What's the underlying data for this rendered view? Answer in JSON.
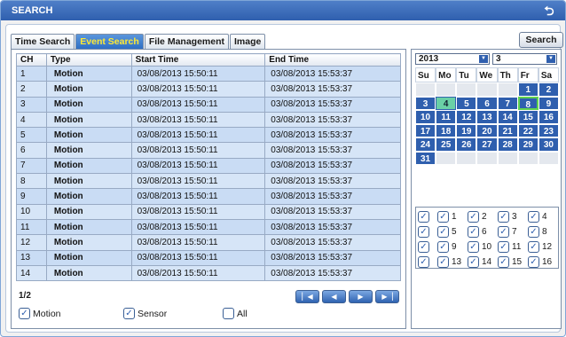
{
  "window": {
    "title": "SEARCH",
    "back_icon": "back-arrow-icon"
  },
  "tabs": [
    {
      "label": "Time Search",
      "active": false
    },
    {
      "label": "Event Search",
      "active": true
    },
    {
      "label": "File Management",
      "active": false
    },
    {
      "label": "Image",
      "active": false
    }
  ],
  "search_button": {
    "label": "Search"
  },
  "table": {
    "headers": [
      "CH",
      "Type",
      "Start Time",
      "End Time"
    ],
    "rows": [
      {
        "ch": "1",
        "type": "Motion",
        "start": "03/08/2013 15:50:11",
        "end": "03/08/2013 15:53:37"
      },
      {
        "ch": "2",
        "type": "Motion",
        "start": "03/08/2013 15:50:11",
        "end": "03/08/2013 15:53:37"
      },
      {
        "ch": "3",
        "type": "Motion",
        "start": "03/08/2013 15:50:11",
        "end": "03/08/2013 15:53:37"
      },
      {
        "ch": "4",
        "type": "Motion",
        "start": "03/08/2013 15:50:11",
        "end": "03/08/2013 15:53:37"
      },
      {
        "ch": "5",
        "type": "Motion",
        "start": "03/08/2013 15:50:11",
        "end": "03/08/2013 15:53:37"
      },
      {
        "ch": "6",
        "type": "Motion",
        "start": "03/08/2013 15:50:11",
        "end": "03/08/2013 15:53:37"
      },
      {
        "ch": "7",
        "type": "Motion",
        "start": "03/08/2013 15:50:11",
        "end": "03/08/2013 15:53:37"
      },
      {
        "ch": "8",
        "type": "Motion",
        "start": "03/08/2013 15:50:11",
        "end": "03/08/2013 15:53:37"
      },
      {
        "ch": "9",
        "type": "Motion",
        "start": "03/08/2013 15:50:11",
        "end": "03/08/2013 15:53:37"
      },
      {
        "ch": "10",
        "type": "Motion",
        "start": "03/08/2013 15:50:11",
        "end": "03/08/2013 15:53:37"
      },
      {
        "ch": "11",
        "type": "Motion",
        "start": "03/08/2013 15:50:11",
        "end": "03/08/2013 15:53:37"
      },
      {
        "ch": "12",
        "type": "Motion",
        "start": "03/08/2013 15:50:11",
        "end": "03/08/2013 15:53:37"
      },
      {
        "ch": "13",
        "type": "Motion",
        "start": "03/08/2013 15:50:11",
        "end": "03/08/2013 15:53:37"
      },
      {
        "ch": "14",
        "type": "Motion",
        "start": "03/08/2013 15:50:11",
        "end": "03/08/2013 15:53:37"
      }
    ],
    "page": "1/2"
  },
  "pager": {
    "first_icon": "skip-first-icon",
    "prev_icon": "prev-icon",
    "next_icon": "next-icon",
    "last_icon": "skip-last-icon"
  },
  "filters": [
    {
      "label": "Motion",
      "checked": true
    },
    {
      "label": "Sensor",
      "checked": true
    },
    {
      "label": "All",
      "checked": false
    }
  ],
  "calendar": {
    "year": "2013",
    "month": "3",
    "weekdays": [
      "Su",
      "Mo",
      "Tu",
      "We",
      "Th",
      "Fr",
      "Sa"
    ],
    "days": [
      {
        "d": "",
        "state": "blank"
      },
      {
        "d": "",
        "state": "blank"
      },
      {
        "d": "",
        "state": "blank"
      },
      {
        "d": "",
        "state": "blank"
      },
      {
        "d": "",
        "state": "blank"
      },
      {
        "d": "1",
        "state": "has"
      },
      {
        "d": "2",
        "state": "has"
      },
      {
        "d": "3",
        "state": "has"
      },
      {
        "d": "4",
        "state": "today"
      },
      {
        "d": "5",
        "state": "has"
      },
      {
        "d": "6",
        "state": "has"
      },
      {
        "d": "7",
        "state": "has"
      },
      {
        "d": "8",
        "state": "event"
      },
      {
        "d": "9",
        "state": "has"
      },
      {
        "d": "10",
        "state": "has"
      },
      {
        "d": "11",
        "state": "has"
      },
      {
        "d": "12",
        "state": "has"
      },
      {
        "d": "13",
        "state": "has"
      },
      {
        "d": "14",
        "state": "has"
      },
      {
        "d": "15",
        "state": "has"
      },
      {
        "d": "16",
        "state": "has"
      },
      {
        "d": "17",
        "state": "has"
      },
      {
        "d": "18",
        "state": "has"
      },
      {
        "d": "19",
        "state": "has"
      },
      {
        "d": "20",
        "state": "has"
      },
      {
        "d": "21",
        "state": "has"
      },
      {
        "d": "22",
        "state": "has"
      },
      {
        "d": "23",
        "state": "has"
      },
      {
        "d": "24",
        "state": "has"
      },
      {
        "d": "25",
        "state": "has"
      },
      {
        "d": "26",
        "state": "has"
      },
      {
        "d": "27",
        "state": "has"
      },
      {
        "d": "28",
        "state": "has"
      },
      {
        "d": "29",
        "state": "has"
      },
      {
        "d": "30",
        "state": "has"
      },
      {
        "d": "31",
        "state": "has"
      },
      {
        "d": "",
        "state": "blank"
      },
      {
        "d": "",
        "state": "blank"
      },
      {
        "d": "",
        "state": "blank"
      },
      {
        "d": "",
        "state": "blank"
      },
      {
        "d": "",
        "state": "blank"
      },
      {
        "d": "",
        "state": "blank"
      }
    ]
  },
  "channels": {
    "all_checked": true,
    "items": [
      {
        "label": "1",
        "checked": true
      },
      {
        "label": "2",
        "checked": true
      },
      {
        "label": "3",
        "checked": true
      },
      {
        "label": "4",
        "checked": true
      },
      {
        "label": "5",
        "checked": true
      },
      {
        "label": "6",
        "checked": true
      },
      {
        "label": "7",
        "checked": true
      },
      {
        "label": "8",
        "checked": true
      },
      {
        "label": "9",
        "checked": true
      },
      {
        "label": "10",
        "checked": true
      },
      {
        "label": "11",
        "checked": true
      },
      {
        "label": "12",
        "checked": true
      },
      {
        "label": "13",
        "checked": true
      },
      {
        "label": "14",
        "checked": true
      },
      {
        "label": "15",
        "checked": true
      },
      {
        "label": "16",
        "checked": true
      }
    ]
  }
}
